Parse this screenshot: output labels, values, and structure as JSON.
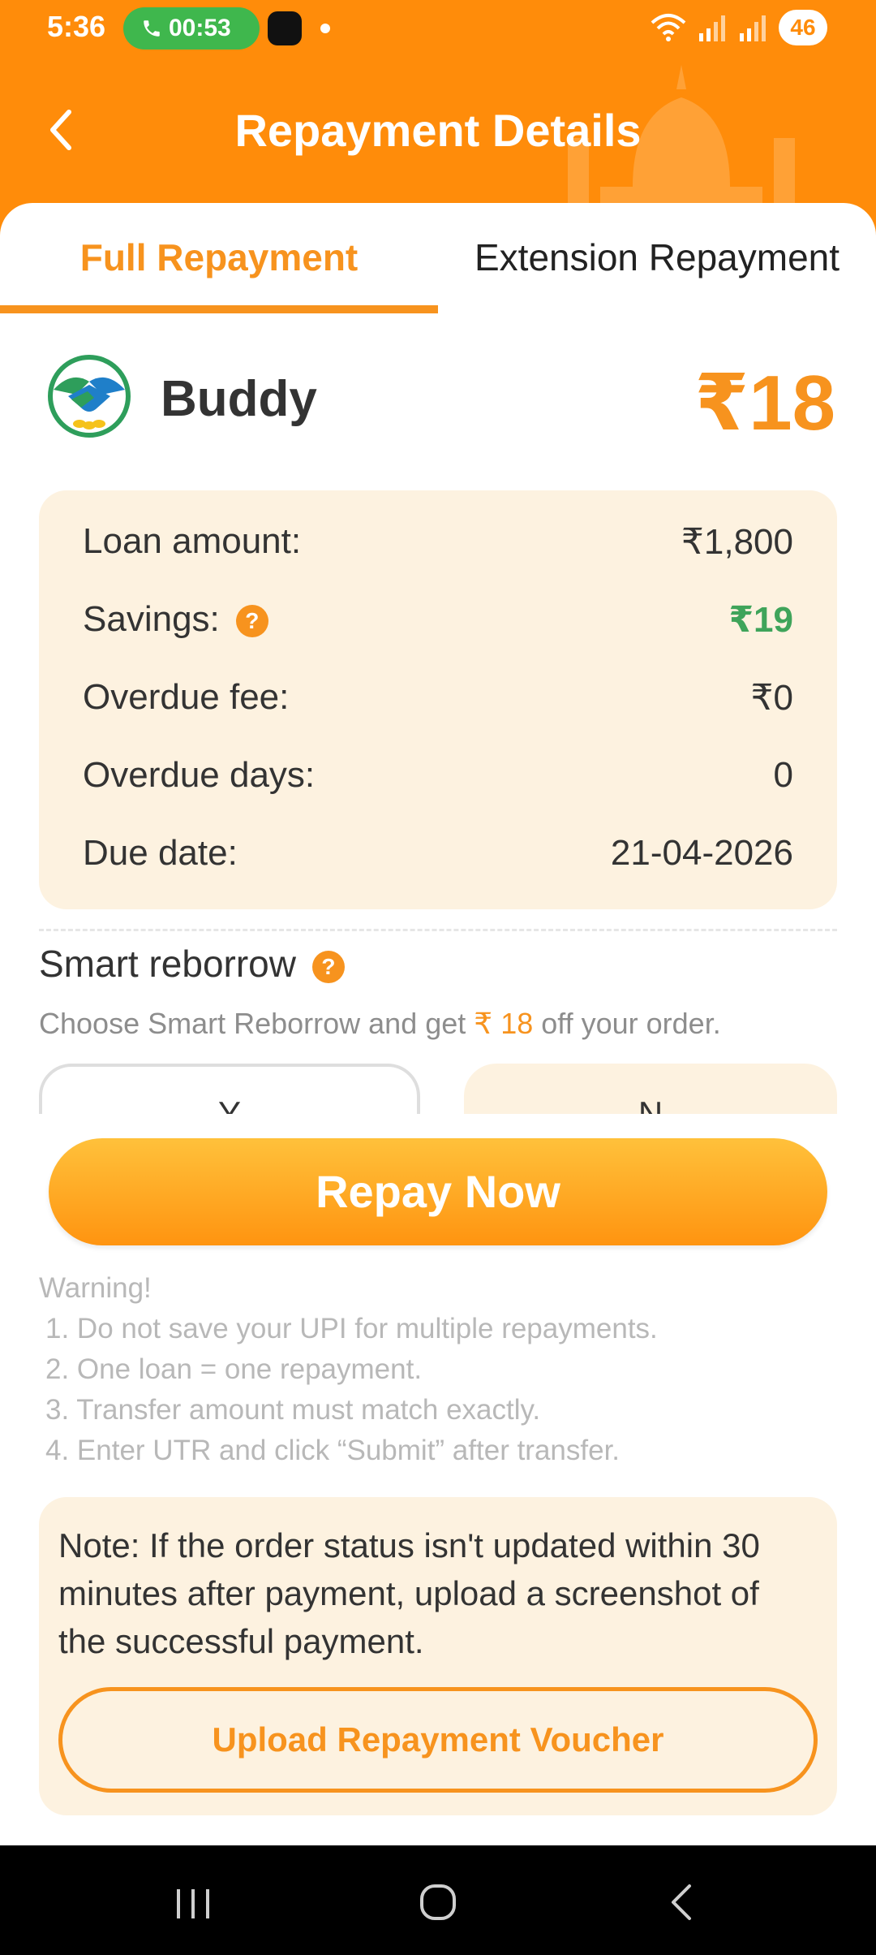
{
  "status_bar": {
    "time": "5:36",
    "call_duration": "00:53",
    "battery": "46"
  },
  "header": {
    "title": "Repayment Details"
  },
  "tabs": [
    {
      "label": "Full Repayment",
      "active": true
    },
    {
      "label": "Extension Repayment",
      "active": false
    }
  ],
  "lender": {
    "name": "Buddy",
    "amount": "₹18"
  },
  "details": {
    "loan_amount_label": "Loan amount:",
    "loan_amount_value": "₹1,800",
    "savings_label": "Savings:",
    "savings_value": "₹19",
    "overdue_fee_label": "Overdue fee:",
    "overdue_fee_value": "₹0",
    "overdue_days_label": "Overdue days:",
    "overdue_days_value": "0",
    "due_date_label": "Due date:",
    "due_date_value": "21-04-2026"
  },
  "smart_reborrow": {
    "title": "Smart reborrow",
    "desc_prefix": "Choose Smart Reborrow and get ",
    "desc_amount": "₹ 18",
    "desc_suffix": " off your order.",
    "option_yes": "Y",
    "option_no": "N"
  },
  "repay_button": "Repay Now",
  "warning": {
    "heading": "Warning!",
    "items": [
      "1. Do not save your UPI for multiple repayments.",
      "2. One loan = one repayment.",
      "3. Transfer amount must match exactly.",
      "4. Enter UTR and click “Submit” after transfer."
    ]
  },
  "note": {
    "text": "Note: If the order status isn't updated within 30 minutes after payment, upload a screenshot of the successful payment.",
    "button": "Upload Repayment Voucher"
  },
  "colors": {
    "brand_orange": "#ff8c0a",
    "accent": "#f7931e",
    "savings_green": "#3fa45a",
    "panel_bg": "#fdf2e0"
  },
  "icons": [
    "back-arrow-icon",
    "phone-icon",
    "wifi-icon",
    "signal-icon",
    "help-icon",
    "recents-nav-icon",
    "home-nav-icon",
    "back-nav-icon"
  ]
}
